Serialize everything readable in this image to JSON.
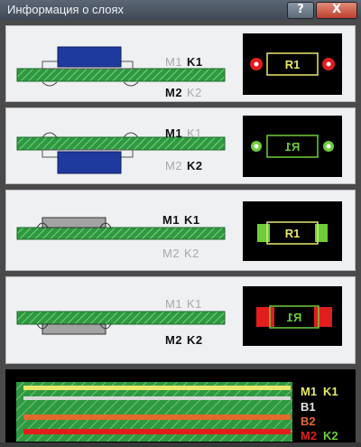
{
  "window": {
    "title": "Информация о слоях",
    "help_label": "?",
    "close_label": "X"
  },
  "panels": [
    {
      "top": {
        "m": "M1",
        "k": "K1"
      },
      "bottom": {
        "m": "M2",
        "k": "K2"
      },
      "preview_label": "R1"
    },
    {
      "top": {
        "m": "M1",
        "k": "K1"
      },
      "bottom": {
        "m": "M2",
        "k": "K2"
      },
      "preview_label": "R1"
    },
    {
      "top": {
        "m": "M1",
        "k": "K1"
      },
      "bottom": {
        "m": "M2",
        "k": "K2"
      },
      "preview_label": "R1"
    },
    {
      "top": {
        "m": "M1",
        "k": "K1"
      },
      "bottom": {
        "m": "M2",
        "k": "K2"
      },
      "preview_label": "R1"
    }
  ],
  "stack": {
    "m1": "M1",
    "k1": "K1",
    "b1": "B1",
    "b2": "B2",
    "m2": "M2",
    "k2": "K2"
  },
  "colors": {
    "board": "#2e9a3f",
    "body_blue": "#1f3a9e",
    "body_gray": "#9c9c9c",
    "silk_yellow": "#e8e86a",
    "pad_red": "#e11d1d",
    "pad_green": "#6ccd3c"
  }
}
